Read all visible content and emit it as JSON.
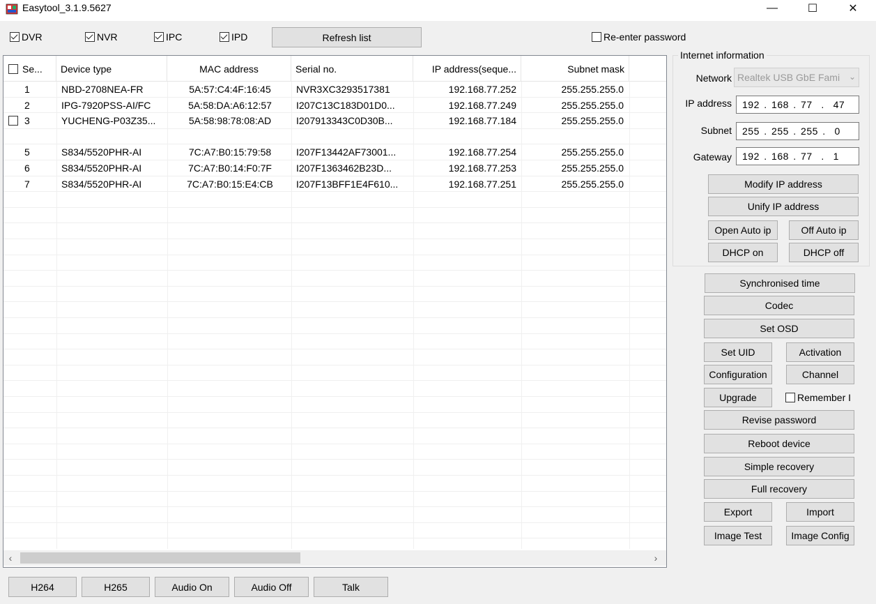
{
  "window": {
    "title": "Easytool_3.1.9.5627",
    "minimize_glyph": "—",
    "maximize_glyph": "☐",
    "close_glyph": "✕"
  },
  "filters": {
    "dvr": {
      "label": "DVR",
      "checked": true
    },
    "nvr": {
      "label": "NVR",
      "checked": true
    },
    "ipc": {
      "label": "IPC",
      "checked": true
    },
    "ipd": {
      "label": "IPD",
      "checked": true
    },
    "refresh_label": "Refresh list",
    "reenter_password_label": "Re-enter password"
  },
  "table": {
    "columns": {
      "seq": "Se...",
      "device_type": "Device type",
      "mac": "MAC address",
      "serial": "Serial no.",
      "ip": "IP address(seque...",
      "subnet": "Subnet mask"
    },
    "rows": [
      {
        "seq": "1",
        "device_type": "NBD-2708NEA-FR",
        "mac": "5A:57:C4:4F:16:45",
        "serial": "NVR3XC3293517381",
        "ip": "192.168.77.252",
        "subnet": "255.255.255.0",
        "checkbox": false
      },
      {
        "seq": "2",
        "device_type": "IPG-7920PSS-AI/FC",
        "mac": "5A:58:DA:A6:12:57",
        "serial": "I207C13C183D01D0...",
        "ip": "192.168.77.249",
        "subnet": "255.255.255.0",
        "checkbox": false
      },
      {
        "seq": "3",
        "device_type": "YUCHENG-P03Z35...",
        "mac": "5A:58:98:78:08:AD",
        "serial": "I207913343C0D30B...",
        "ip": "192.168.77.184",
        "subnet": "255.255.255.0",
        "checkbox": true
      },
      {
        "seq": "",
        "device_type": "",
        "mac": "",
        "serial": "",
        "ip": "",
        "subnet": "",
        "checkbox": false
      },
      {
        "seq": "5",
        "device_type": "S834/5520PHR-AI",
        "mac": "7C:A7:B0:15:79:58",
        "serial": "I207F13442AF73001...",
        "ip": "192.168.77.254",
        "subnet": "255.255.255.0",
        "checkbox": false
      },
      {
        "seq": "6",
        "device_type": "S834/5520PHR-AI",
        "mac": "7C:A7:B0:14:F0:7F",
        "serial": "I207F1363462B23D...",
        "ip": "192.168.77.253",
        "subnet": "255.255.255.0",
        "checkbox": false
      },
      {
        "seq": "7",
        "device_type": "S834/5520PHR-AI",
        "mac": "7C:A7:B0:15:E4:CB",
        "serial": "I207F13BFF1E4F610...",
        "ip": "192.168.77.251",
        "subnet": "255.255.255.0",
        "checkbox": false
      }
    ],
    "scroll_left_glyph": "‹",
    "scroll_right_glyph": "›"
  },
  "internet": {
    "group_title": "Internet information",
    "network_label": "Network",
    "network_value": "Realtek USB GbE Fami",
    "network_chevron": "⌄",
    "ip_label": "IP address",
    "ip_value": "192 . 168 . 77  .  47",
    "subnet_label": "Subnet",
    "subnet_value": "255 . 255 . 255 .  0",
    "gateway_label": "Gateway",
    "gateway_value": "192 . 168 . 77  .  1",
    "modify_ip": "Modify IP address",
    "unify_ip": "Unify IP address",
    "open_auto_ip": "Open Auto ip",
    "off_auto_ip": "Off Auto ip",
    "dhcp_on": "DHCP on",
    "dhcp_off": "DHCP off"
  },
  "actions": {
    "sync_time": "Synchronised time",
    "codec": "Codec",
    "set_osd": "Set OSD",
    "set_uid": "Set UID",
    "activation": "Activation",
    "configuration": "Configuration",
    "channel": "Channel",
    "upgrade": "Upgrade",
    "remember_label": "Remember I",
    "revise_password": "Revise password",
    "reboot_device": "Reboot device",
    "simple_recovery": "Simple recovery",
    "full_recovery": "Full recovery",
    "export": "Export",
    "import": "Import",
    "image_test": "Image Test",
    "image_config": "Image Config"
  },
  "bottom": {
    "h264": "H264",
    "h265": "H265",
    "audio_on": "Audio On",
    "audio_off": "Audio Off",
    "talk": "Talk"
  }
}
